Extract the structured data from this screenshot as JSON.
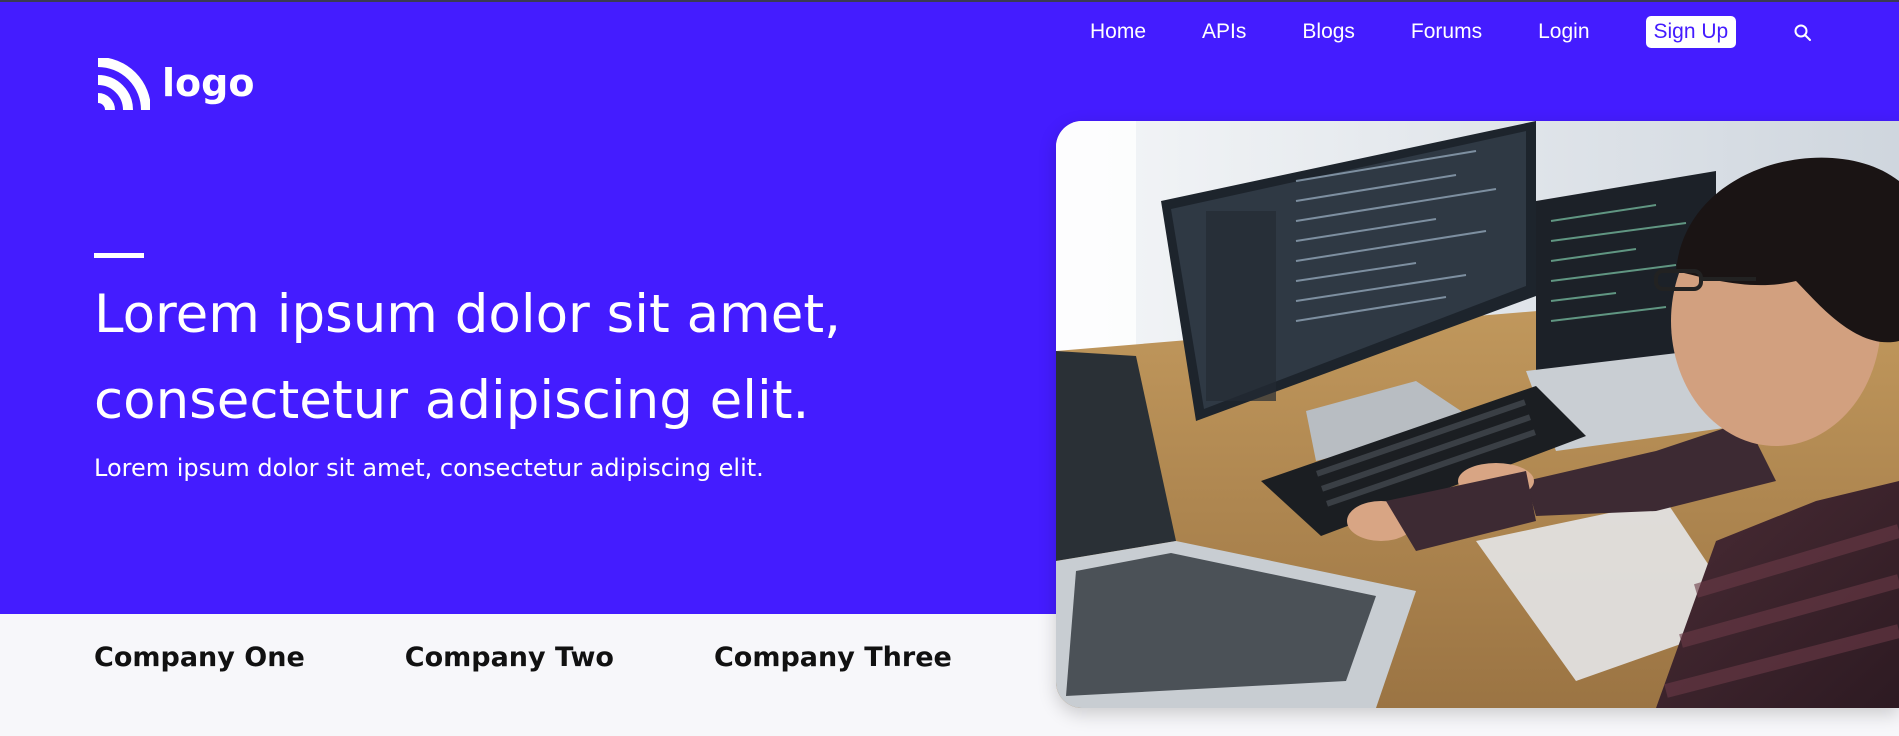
{
  "nav": {
    "items": [
      {
        "label": "Home"
      },
      {
        "label": "APIs"
      },
      {
        "label": "Blogs"
      },
      {
        "label": "Forums"
      },
      {
        "label": "Login"
      }
    ],
    "signup_label": "Sign Up",
    "search_icon": "search-icon"
  },
  "logo": {
    "text": "logo",
    "icon": "wifi-arcs-icon"
  },
  "hero": {
    "headline": "Lorem ipsum dolor sit amet, consectetur adipiscing elit.",
    "subheadline": "Lorem ipsum dolor sit amet, consectetur adipiscing elit.",
    "image_description": "developer-at-desk-photo"
  },
  "companies": [
    {
      "name": "Company One"
    },
    {
      "name": "Company Two"
    },
    {
      "name": "Company Three"
    }
  ],
  "colors": {
    "brand": "#441cff",
    "background_light": "#f7f7fa",
    "text_dark": "#111111",
    "white": "#ffffff"
  }
}
